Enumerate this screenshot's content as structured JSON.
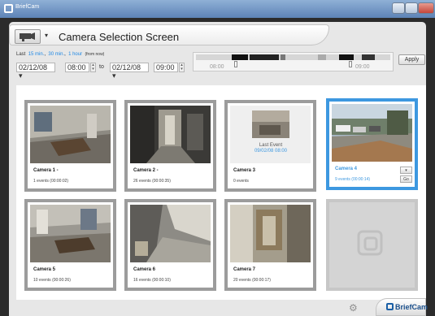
{
  "window": {
    "title": "BriefCam"
  },
  "header": {
    "title": "Camera Selection Screen"
  },
  "filter": {
    "last_label": "Last",
    "quick_links": [
      "15 min.",
      "30 min.",
      "1 hour"
    ],
    "from_now": "(from now)",
    "from_date": "02/12/08",
    "from_time": "08:00",
    "to_label": "to",
    "to_date": "02/12/08",
    "to_time": "09:00"
  },
  "timeline": {
    "start_time": "08:00",
    "end_time": "09:00"
  },
  "apply_label": "Apply",
  "cameras": [
    {
      "name": "Camera 1 -",
      "events": "1 events (00:00:02)"
    },
    {
      "name": "Camera 2 -",
      "events": "26 events (00:00:35)"
    },
    {
      "name": "Camera 3",
      "events": "0 events",
      "last_event_label": "Last Event",
      "last_event_time": "09/02/08 08:00"
    },
    {
      "name": "Camera 4",
      "events": "9 events (00:00:14)",
      "selected": true,
      "buttons": [
        "▾",
        "Go"
      ]
    },
    {
      "name": "Camera 5",
      "events": "10 events (00:00:26)"
    },
    {
      "name": "Camera 6",
      "events": "16 events (00:00:10)"
    },
    {
      "name": "Camera 7",
      "events": "20 events (00:00:17)"
    }
  ],
  "empty_slot_logo": "BriefCam",
  "footer": {
    "brand": "BriefCam",
    "settings_icon": "gear-icon"
  },
  "colors": {
    "accent": "#3d98e0",
    "brand": "#1a4f8c"
  }
}
